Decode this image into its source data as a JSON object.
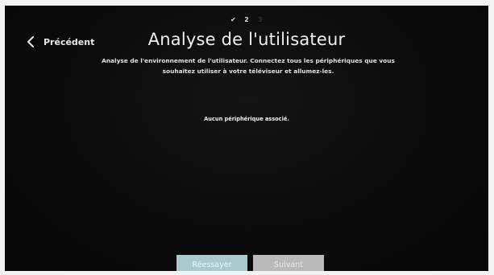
{
  "progress": {
    "steps": [
      {
        "label": "✔",
        "state": "done"
      },
      {
        "label": "2",
        "state": "current"
      },
      {
        "label": "3",
        "state": "upcoming"
      }
    ]
  },
  "header": {
    "back_label": "Précédent",
    "title": "Analyse de l'utilisateur",
    "subtitle_line1": "Analyse de l'environnement de l'utilisateur. Connectez tous les périphériques que vous",
    "subtitle_line2": "souhaitez utiliser à votre téléviseur et allumez-les."
  },
  "main": {
    "status_text": "Aucun périphérique associé."
  },
  "footer": {
    "retry_label": "Réessayer",
    "next_label": "Suivant"
  },
  "colors": {
    "background": "#0b0b0b",
    "retry_button": "#a9c9d0",
    "next_button": "#b9b9b9"
  },
  "icons": {
    "back": "chevron-left-icon"
  }
}
